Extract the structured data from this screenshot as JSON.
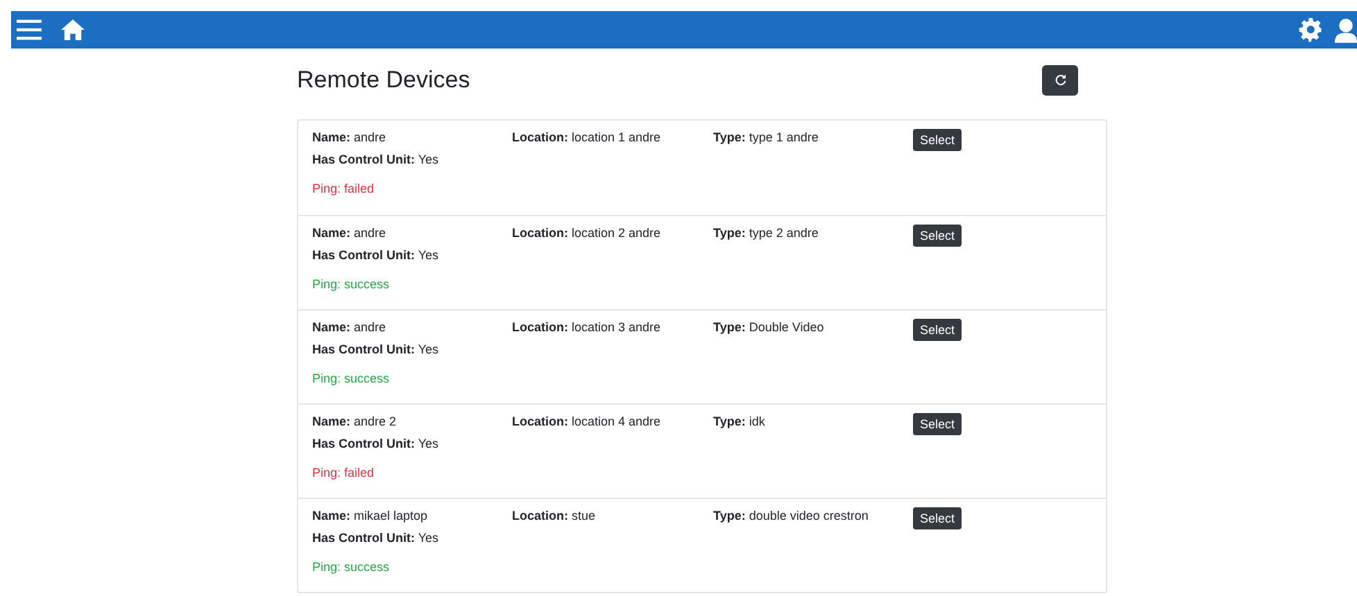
{
  "page_title": "Remote Devices",
  "devices": [
    {
      "name": "**Name:** andre",
      "control_unit": "**Has Control Unit:** Yes",
      "ping": "Ping: failed",
      "ping_ok": false,
      "location": "**Location:** location 1 andre",
      "type": "**Type:** type 1 andre",
      "button": "Select"
    },
    {
      "name": "**Name:** andre",
      "control_unit": "**Has Control Unit:** Yes",
      "ping": "Ping: success",
      "ping_ok": true,
      "location": "**Location:** location 2 andre",
      "type": "**Type:** type 2 andre",
      "button": "Select"
    },
    {
      "name": "**Name:** andre",
      "control_unit": "**Has Control Unit:** Yes",
      "ping": "Ping: success",
      "ping_ok": true,
      "location": "**Location:** location 3 andre",
      "type": "**Type:** Double Video",
      "button": "Select"
    },
    {
      "name": "**Name:** andre 2",
      "control_unit": "**Has Control Unit:** Yes",
      "ping": "Ping: failed",
      "ping_ok": false,
      "location": "**Location:** location 4 andre",
      "type": "**Type:** idk",
      "button": "Select"
    },
    {
      "name": "**Name:** mikael laptop",
      "control_unit": "**Has Control Unit:** Yes",
      "ping": "Ping: success",
      "ping_ok": true,
      "location": "**Location:** stue",
      "type": "**Type:** double video crestron",
      "button": "Select"
    }
  ]
}
